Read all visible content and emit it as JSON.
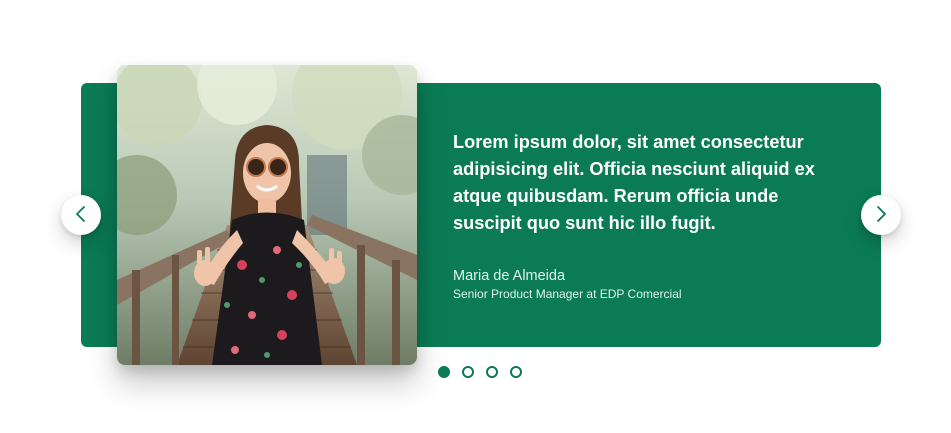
{
  "theme": {
    "accent": "#0b7b56",
    "card_bg": "#0b7b56",
    "text_on_accent": "#ffffff"
  },
  "testimonial": {
    "quote": "Lorem ipsum dolor, sit amet consectetur adipisicing elit. Officia nesciunt aliquid ex atque quibusdam. Rerum officia unde suscipit quo sunt hic illo fugit.",
    "author_name": "Maria de Almeida",
    "author_role": "Senior Product Manager at EDP Comercial",
    "photo": "smiling-woman-peace-sign-on-wooden-bridge"
  },
  "carousel": {
    "prev_icon": "chevron-left-icon",
    "next_icon": "chevron-right-icon",
    "slide_count": 4,
    "active_index": 0
  }
}
